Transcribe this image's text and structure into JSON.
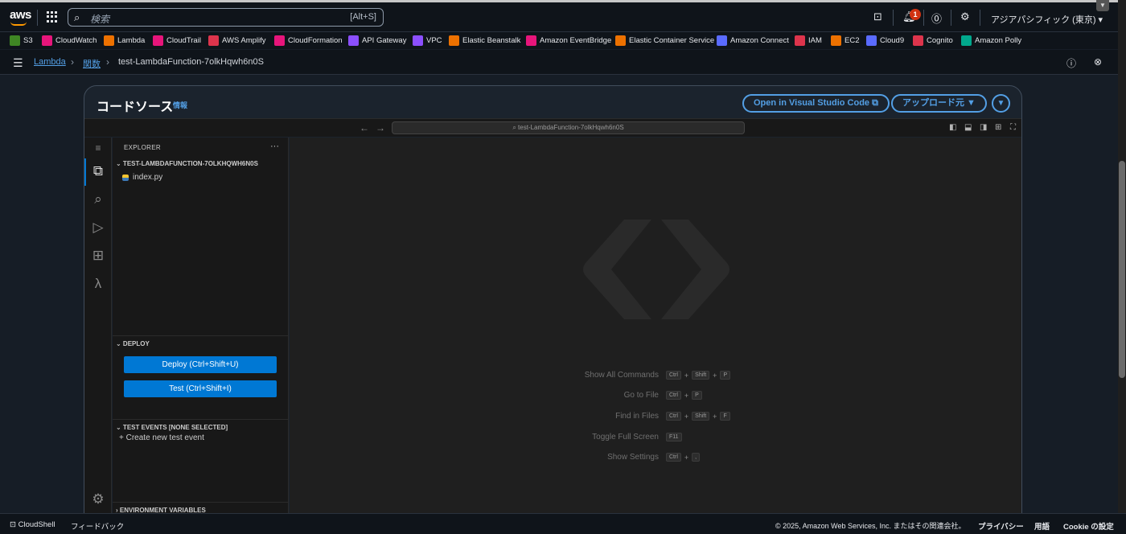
{
  "topnav": {
    "logo": "aws",
    "search_placeholder": "検索",
    "search_shortcut": "[Alt+S]",
    "notification_count": "1",
    "region": "アジアパシフィック (東京) ▾"
  },
  "favorites": [
    {
      "label": "S3",
      "color": "#3f8624"
    },
    {
      "label": "CloudWatch",
      "color": "#e7157b"
    },
    {
      "label": "Lambda",
      "color": "#ed7100"
    },
    {
      "label": "CloudTrail",
      "color": "#e7157b"
    },
    {
      "label": "AWS Amplify",
      "color": "#dd344c"
    },
    {
      "label": "CloudFormation",
      "color": "#e7157b"
    },
    {
      "label": "API Gateway",
      "color": "#8c4fff"
    },
    {
      "label": "VPC",
      "color": "#8c4fff"
    },
    {
      "label": "Elastic Beanstalk",
      "color": "#ed7100"
    },
    {
      "label": "Amazon EventBridge",
      "color": "#e7157b"
    },
    {
      "label": "Elastic Container Service",
      "color": "#ed7100"
    },
    {
      "label": "Amazon Connect",
      "color": "#5a6bff"
    },
    {
      "label": "IAM",
      "color": "#dd344c"
    },
    {
      "label": "EC2",
      "color": "#ed7100"
    },
    {
      "label": "Cloud9",
      "color": "#5a6bff"
    },
    {
      "label": "Cognito",
      "color": "#dd344c"
    },
    {
      "label": "Amazon Polly",
      "color": "#01a88d"
    }
  ],
  "breadcrumb": {
    "lambda": "Lambda",
    "functions": "関数",
    "current": "test-LambdaFunction-7olkHqwh6n0S"
  },
  "panel": {
    "title": "コードソース",
    "info": "情報",
    "vscode_button": "Open in Visual Studio Code ⧉",
    "upload_button": "アップロード元 ▼",
    "menu_button": "▼"
  },
  "ide": {
    "search_text": "⌕ test-LambdaFunction-7olkHqwh6n0S",
    "explorer_title": "EXPLORER",
    "more": "···",
    "folder": "⌄ TEST-LAMBDAFUNCTION-7OLKHQWH6N0S",
    "file": "index.py",
    "deploy_section": "⌄ DEPLOY",
    "deploy_button": "Deploy (Ctrl+Shift+U)",
    "test_button": "Test (Ctrl+Shift+I)",
    "test_events_section": "⌄ TEST EVENTS [NONE SELECTED]",
    "create_event": "+  Create new test event",
    "env_section": "› ENVIRONMENT VARIABLES"
  },
  "hints": [
    {
      "label": "Show All Commands",
      "keys": [
        "Ctrl",
        "Shift",
        "P"
      ]
    },
    {
      "label": "Go to File",
      "keys": [
        "Ctrl",
        "P"
      ]
    },
    {
      "label": "Find in Files",
      "keys": [
        "Ctrl",
        "Shift",
        "F"
      ]
    },
    {
      "label": "Toggle Full Screen",
      "keys": [
        "F11"
      ]
    },
    {
      "label": "Show Settings",
      "keys": [
        "Ctrl",
        ","
      ]
    }
  ],
  "footer": {
    "cloudshell": "CloudShell",
    "feedback": "フィードバック",
    "copyright": "© 2025, Amazon Web Services, Inc. またはその関連会社。",
    "privacy": "プライバシー",
    "terms": "用語",
    "cookie": "Cookie の設定"
  }
}
